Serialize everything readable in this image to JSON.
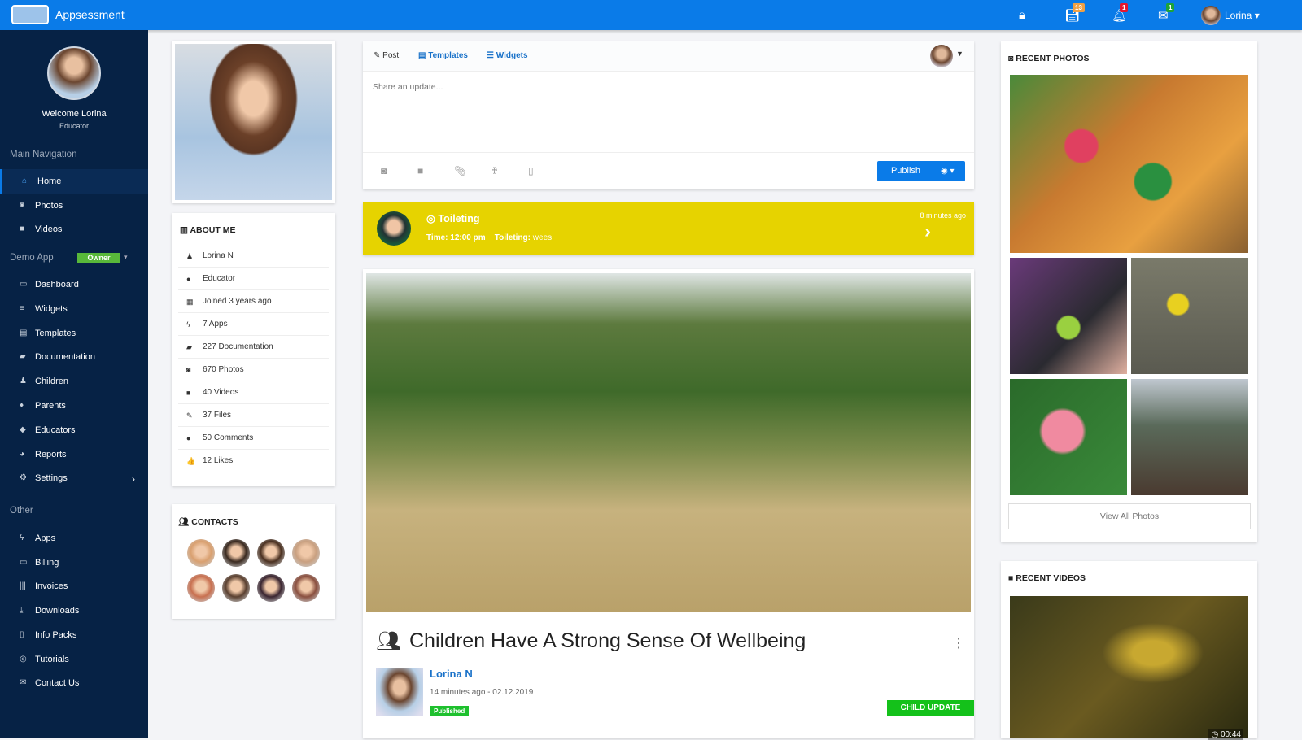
{
  "header": {
    "brand": "Appsessment",
    "save_badge": "13",
    "notif_badge": "1",
    "mail_badge": "1",
    "user": "Lorina"
  },
  "sidebar": {
    "welcome": "Welcome Lorina",
    "role": "Educator",
    "main_nav": "Main Navigation",
    "main_items": [
      {
        "label": "Home",
        "icon": "home-icon",
        "glyph": "⌂"
      },
      {
        "label": "Photos",
        "icon": "camera-icon",
        "glyph": "◙"
      },
      {
        "label": "Videos",
        "icon": "video-icon",
        "glyph": "■"
      }
    ],
    "demo_app": "Demo App",
    "owner_badge": "Owner",
    "demo_items": [
      {
        "label": "Dashboard",
        "glyph": "▭"
      },
      {
        "label": "Widgets",
        "glyph": "≡"
      },
      {
        "label": "Templates",
        "glyph": "▤"
      },
      {
        "label": "Documentation",
        "glyph": "▰"
      },
      {
        "label": "Children",
        "glyph": "♟"
      },
      {
        "label": "Parents",
        "glyph": "♦"
      },
      {
        "label": "Educators",
        "glyph": "◆"
      },
      {
        "label": "Reports",
        "glyph": "◕"
      },
      {
        "label": "Settings",
        "glyph": "⚙"
      }
    ],
    "other": "Other",
    "other_items": [
      {
        "label": "Apps",
        "glyph": "ϟ"
      },
      {
        "label": "Billing",
        "glyph": "▭"
      },
      {
        "label": "Invoices",
        "glyph": "|||"
      },
      {
        "label": "Downloads",
        "glyph": "⤓"
      },
      {
        "label": "Info Packs",
        "glyph": "▯"
      },
      {
        "label": "Tutorials",
        "glyph": "◎"
      },
      {
        "label": "Contact Us",
        "glyph": "✉"
      }
    ]
  },
  "about": {
    "title": "ABOUT ME",
    "rows": [
      {
        "text": "Lorina N",
        "glyph": "♟"
      },
      {
        "text": "Educator",
        "glyph": "●"
      },
      {
        "text": "Joined 3 years ago",
        "glyph": "▦"
      },
      {
        "text": "7 Apps",
        "glyph": "ϟ"
      },
      {
        "text": "227 Documentation",
        "glyph": "▰"
      },
      {
        "text": "670 Photos",
        "glyph": "◙"
      },
      {
        "text": "40 Videos",
        "glyph": "■"
      },
      {
        "text": "37 Files",
        "glyph": "✎"
      },
      {
        "text": "50 Comments",
        "glyph": "●"
      },
      {
        "text": "12 Likes",
        "glyph": "👍"
      }
    ]
  },
  "contacts": {
    "title": "CONTACTS"
  },
  "composer": {
    "tabs": [
      "Post",
      "Templates",
      "Widgets"
    ],
    "placeholder": "Share an update...",
    "publish": "Publish"
  },
  "toileting": {
    "title": "Toileting",
    "time": "Time: 12:00 pm",
    "detail_label": "Toileting:",
    "detail_value": "wees",
    "ago": "8 minutes ago",
    "color": "#e6d300"
  },
  "post": {
    "title": "Children Have A Strong Sense Of Wellbeing",
    "author": "Lorina N",
    "meta": "14 minutes ago - 02.12.2019",
    "status": "Published",
    "tag": "CHILD UPDATE"
  },
  "recent_photos": {
    "title": "RECENT PHOTOS",
    "view_all": "View All Photos"
  },
  "recent_videos": {
    "title": "RECENT VIDEOS",
    "duration": "00:44"
  }
}
